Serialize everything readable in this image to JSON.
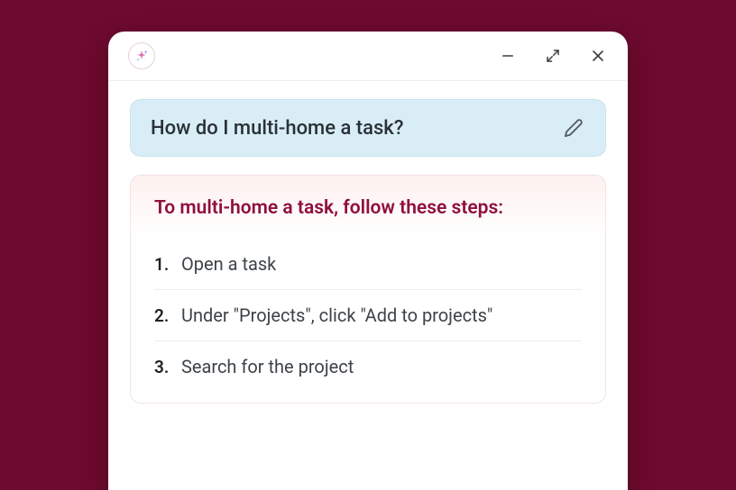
{
  "question": {
    "text": "How do I multi-home a task?"
  },
  "answer": {
    "title": "To multi-home a task, follow these steps:",
    "steps": [
      {
        "num": "1.",
        "text": "Open a task"
      },
      {
        "num": "2.",
        "text": "Under \"Projects\", click \"Add to projects\""
      },
      {
        "num": "3.",
        "text": "Search for the project"
      }
    ]
  }
}
